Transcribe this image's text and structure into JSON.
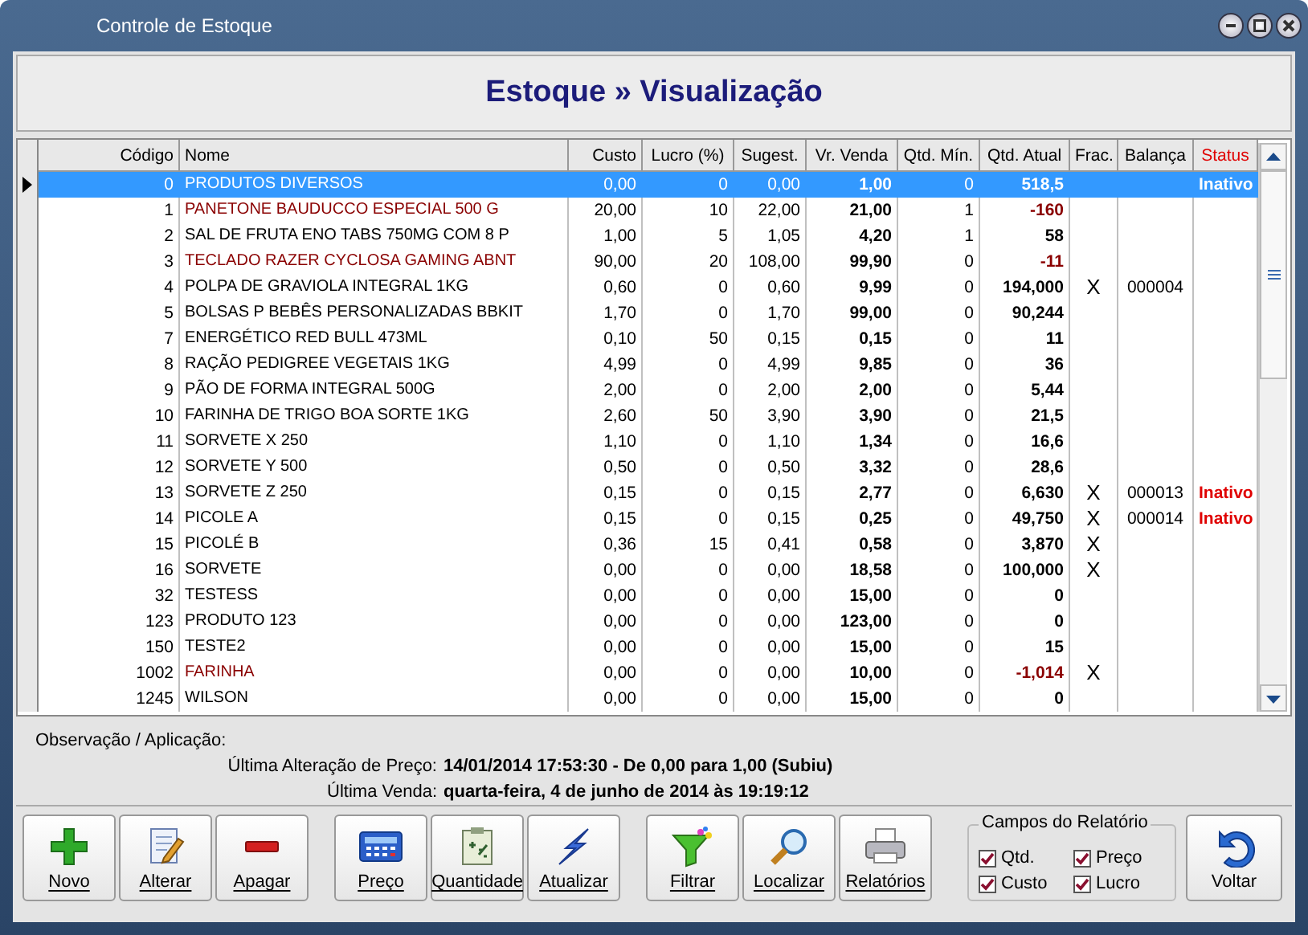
{
  "window": {
    "title": "Controle de Estoque"
  },
  "heading": "Estoque » Visualização",
  "table": {
    "columns": [
      "Código",
      "Nome",
      "Custo",
      "Lucro (%)",
      "Sugest.",
      "Vr. Venda",
      "Qtd. Mín.",
      "Qtd. Atual",
      "Frac.",
      "Balança",
      "Status"
    ],
    "rows": [
      {
        "selected": true,
        "name_alert": false,
        "qty_alert": false,
        "cells": [
          "0",
          "PRODUTOS DIVERSOS",
          "0,00",
          "0",
          "0,00",
          "1,00",
          "0",
          "518,5",
          "",
          "",
          "Inativo"
        ]
      },
      {
        "selected": false,
        "name_alert": true,
        "qty_alert": true,
        "cells": [
          "1",
          "PANETONE BAUDUCCO ESPECIAL 500 G",
          "20,00",
          "10",
          "22,00",
          "21,00",
          "1",
          "-160",
          "",
          "",
          ""
        ]
      },
      {
        "selected": false,
        "name_alert": false,
        "qty_alert": false,
        "cells": [
          "2",
          "SAL DE FRUTA ENO TABS 750MG COM 8 P",
          "1,00",
          "5",
          "1,05",
          "4,20",
          "1",
          "58",
          "",
          "",
          ""
        ]
      },
      {
        "selected": false,
        "name_alert": true,
        "qty_alert": true,
        "cells": [
          "3",
          "TECLADO RAZER CYCLOSA GAMING ABNT",
          "90,00",
          "20",
          "108,00",
          "99,90",
          "0",
          "-11",
          "",
          "",
          ""
        ]
      },
      {
        "selected": false,
        "name_alert": false,
        "qty_alert": false,
        "cells": [
          "4",
          "POLPA DE GRAVIOLA INTEGRAL 1KG",
          "0,60",
          "0",
          "0,60",
          "9,99",
          "0",
          "194,000",
          "X",
          "000004",
          ""
        ]
      },
      {
        "selected": false,
        "name_alert": false,
        "qty_alert": false,
        "cells": [
          "5",
          "BOLSAS P BEBÊS PERSONALIZADAS BBKIT",
          "1,70",
          "0",
          "1,70",
          "99,00",
          "0",
          "90,244",
          "",
          "",
          ""
        ]
      },
      {
        "selected": false,
        "name_alert": false,
        "qty_alert": false,
        "cells": [
          "7",
          "ENERGÉTICO RED BULL 473ML",
          "0,10",
          "50",
          "0,15",
          "0,15",
          "0",
          "11",
          "",
          "",
          ""
        ]
      },
      {
        "selected": false,
        "name_alert": false,
        "qty_alert": false,
        "cells": [
          "8",
          "RAÇÃO PEDIGREE VEGETAIS 1KG",
          "4,99",
          "0",
          "4,99",
          "9,85",
          "0",
          "36",
          "",
          "",
          ""
        ]
      },
      {
        "selected": false,
        "name_alert": false,
        "qty_alert": false,
        "cells": [
          "9",
          "PÃO DE FORMA INTEGRAL 500G",
          "2,00",
          "0",
          "2,00",
          "2,00",
          "0",
          "5,44",
          "",
          "",
          ""
        ]
      },
      {
        "selected": false,
        "name_alert": false,
        "qty_alert": false,
        "cells": [
          "10",
          "FARINHA DE TRIGO BOA SORTE 1KG",
          "2,60",
          "50",
          "3,90",
          "3,90",
          "0",
          "21,5",
          "",
          "",
          ""
        ]
      },
      {
        "selected": false,
        "name_alert": false,
        "qty_alert": false,
        "cells": [
          "11",
          "SORVETE X 250",
          "1,10",
          "0",
          "1,10",
          "1,34",
          "0",
          "16,6",
          "",
          "",
          ""
        ]
      },
      {
        "selected": false,
        "name_alert": false,
        "qty_alert": false,
        "cells": [
          "12",
          "SORVETE Y 500",
          "0,50",
          "0",
          "0,50",
          "3,32",
          "0",
          "28,6",
          "",
          "",
          ""
        ]
      },
      {
        "selected": false,
        "name_alert": false,
        "qty_alert": false,
        "cells": [
          "13",
          "SORVETE Z 250",
          "0,15",
          "0",
          "0,15",
          "2,77",
          "0",
          "6,630",
          "X",
          "000013",
          "Inativo"
        ]
      },
      {
        "selected": false,
        "name_alert": false,
        "qty_alert": false,
        "cells": [
          "14",
          "PICOLE A",
          "0,15",
          "0",
          "0,15",
          "0,25",
          "0",
          "49,750",
          "X",
          "000014",
          "Inativo"
        ]
      },
      {
        "selected": false,
        "name_alert": false,
        "qty_alert": false,
        "cells": [
          "15",
          "PICOLÉ B",
          "0,36",
          "15",
          "0,41",
          "0,58",
          "0",
          "3,870",
          "X",
          "",
          ""
        ]
      },
      {
        "selected": false,
        "name_alert": false,
        "qty_alert": false,
        "cells": [
          "16",
          "SORVETE",
          "0,00",
          "0",
          "0,00",
          "18,58",
          "0",
          "100,000",
          "X",
          "",
          ""
        ]
      },
      {
        "selected": false,
        "name_alert": false,
        "qty_alert": false,
        "cells": [
          "32",
          "TESTESS",
          "0,00",
          "0",
          "0,00",
          "15,00",
          "0",
          "0",
          "",
          "",
          ""
        ]
      },
      {
        "selected": false,
        "name_alert": false,
        "qty_alert": false,
        "cells": [
          "123",
          "PRODUTO 123",
          "0,00",
          "0",
          "0,00",
          "123,00",
          "0",
          "0",
          "",
          "",
          ""
        ]
      },
      {
        "selected": false,
        "name_alert": false,
        "qty_alert": false,
        "cells": [
          "150",
          "TESTE2",
          "0,00",
          "0",
          "0,00",
          "15,00",
          "0",
          "15",
          "",
          "",
          ""
        ]
      },
      {
        "selected": false,
        "name_alert": true,
        "qty_alert": true,
        "cells": [
          "1002",
          "FARINHA",
          "0,00",
          "0",
          "0,00",
          "10,00",
          "0",
          "-1,014",
          "X",
          "",
          ""
        ]
      },
      {
        "selected": false,
        "name_alert": false,
        "qty_alert": false,
        "cells": [
          "1245",
          "WILSON",
          "0,00",
          "0",
          "0,00",
          "15,00",
          "0",
          "0",
          "",
          "",
          ""
        ]
      }
    ]
  },
  "info": [
    {
      "label": "Observação / Aplicação:"
    },
    {
      "label": "Última Alteração de Preço:",
      "value": "14/01/2014 17:53:30 - De 0,00 para 1,00 (Subiu)"
    },
    {
      "label": "Última Venda:",
      "value": "quarta-feira, 4 de junho de 2014 às 19:19:12"
    }
  ],
  "toolbar": [
    {
      "kind": "plus",
      "label": "Novo"
    },
    {
      "kind": "edit",
      "label": "Alterar"
    },
    {
      "kind": "minus",
      "label": "Apagar"
    },
    {
      "kind": "gap"
    },
    {
      "kind": "calc",
      "label": "Preço"
    },
    {
      "kind": "clip",
      "label": "Quantidade"
    },
    {
      "kind": "bolt",
      "label": "Atualizar"
    },
    {
      "kind": "gap"
    },
    {
      "kind": "funnel",
      "label": "Filtrar"
    },
    {
      "kind": "lens",
      "label": "Localizar"
    },
    {
      "kind": "printer",
      "label": "Relatórios"
    }
  ],
  "report_fields": {
    "title": "Campos do Relatório",
    "options": [
      {
        "label": "Qtd.",
        "checked": true
      },
      {
        "label": "Preço",
        "checked": true
      },
      {
        "label": "Custo",
        "checked": true
      },
      {
        "label": "Lucro",
        "checked": true
      }
    ]
  },
  "back_button": {
    "label": "Voltar"
  }
}
